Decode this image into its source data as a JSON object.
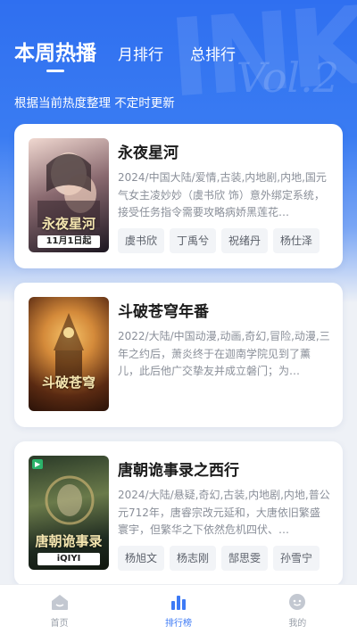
{
  "header": {
    "tabs": [
      {
        "label": "本周热播",
        "active": true
      },
      {
        "label": "月排行",
        "active": false
      },
      {
        "label": "总排行",
        "active": false
      }
    ],
    "subtitle": "根据当前热度整理 不定时更新",
    "watermark": "Vol.2"
  },
  "cards": [
    {
      "title": "永夜星河",
      "desc": "2024/中国大陆/爱情,古装,内地剧,内地,国元气女主凌妙妙（虞书欣 饰）意外绑定系统，接受任务指令需要攻略病娇黑莲花…",
      "actors": [
        "虞书欣",
        "丁禹兮",
        "祝绪丹",
        "杨仕泽"
      ],
      "poster": {
        "title": "永夜星河",
        "date": "11月1日起",
        "colors": [
          "#3a2e38",
          "#8a6a70",
          "#1c1620"
        ]
      }
    },
    {
      "title": "斗破苍穹年番",
      "desc": "2022/大陆/中国动漫,动画,奇幻,冒险,动漫,三年之约后，萧炎终于在迦南学院见到了薰儿，此后他广交挚友并成立磐门；为…",
      "actors": [],
      "poster": {
        "title": "斗破苍穹",
        "date": "",
        "colors": [
          "#5a2a12",
          "#d48a3a",
          "#2a1208"
        ]
      }
    },
    {
      "title": "唐朝诡事录之西行",
      "desc": "2024/大陆/悬疑,奇幻,古装,内地剧,内地,普公元712年，唐睿宗改元延和，大唐依旧繁盛寰宇，但繁华之下依然危机四伏、…",
      "actors": [
        "杨旭文",
        "杨志刚",
        "郜思雯",
        "孙雪宁"
      ],
      "poster": {
        "title": "唐朝诡事录",
        "date": "iQIYI",
        "colors": [
          "#1e2a20",
          "#6a7a4a",
          "#10160e"
        ]
      }
    }
  ],
  "nav": [
    {
      "label": "首页",
      "icon": "home-icon",
      "active": false
    },
    {
      "label": "排行榜",
      "icon": "ranking-icon",
      "active": true
    },
    {
      "label": "我的",
      "icon": "profile-icon",
      "active": false
    }
  ],
  "colors": {
    "accent": "#3d7af5",
    "header": "#2f6ff0",
    "muted": "#9aa0aa"
  }
}
